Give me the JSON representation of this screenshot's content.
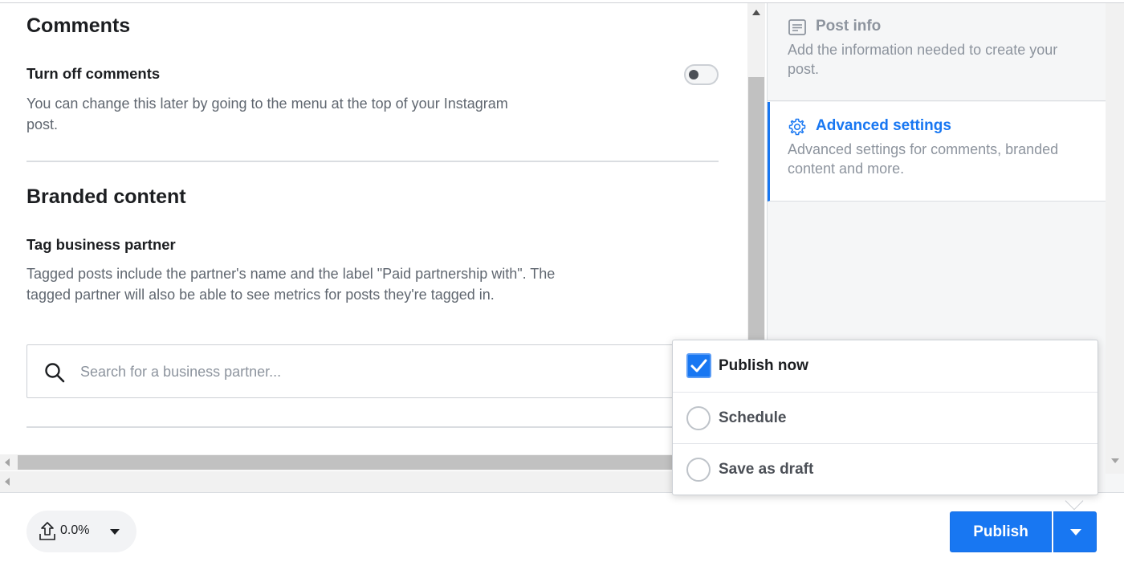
{
  "comments": {
    "heading": "Comments",
    "turn_off_label": "Turn off comments",
    "turn_off_desc": "You can change this later by going to the menu at the top of your Instagram post.",
    "toggle_on": false
  },
  "branded": {
    "heading": "Branded content",
    "tag_label": "Tag business partner",
    "tag_desc": "Tagged posts include the partner's name and the label \"Paid partnership with\". The tagged partner will also be able to see metrics for posts they're tagged in.",
    "search_placeholder": "Search for a business partner...",
    "search_value": ""
  },
  "sidebar": {
    "steps": [
      {
        "title": "Post info",
        "desc": "Add the information needed to create your post.",
        "icon": "document-lines-icon",
        "active": false
      },
      {
        "title": "Advanced settings",
        "desc": "Advanced settings for comments, branded content and more.",
        "icon": "gear-icon",
        "active": true
      }
    ]
  },
  "footer": {
    "upload_progress": "0.0%",
    "publish_label": "Publish"
  },
  "publish_menu": {
    "items": [
      {
        "label": "Publish now",
        "selected": true
      },
      {
        "label": "Schedule",
        "selected": false
      },
      {
        "label": "Save as draft",
        "selected": false
      }
    ]
  },
  "colors": {
    "accent": "#1877f2",
    "text_primary": "#1c1e21",
    "text_secondary": "#606770",
    "text_muted": "#8d949e",
    "sidebar_bg": "#f5f6f7"
  }
}
